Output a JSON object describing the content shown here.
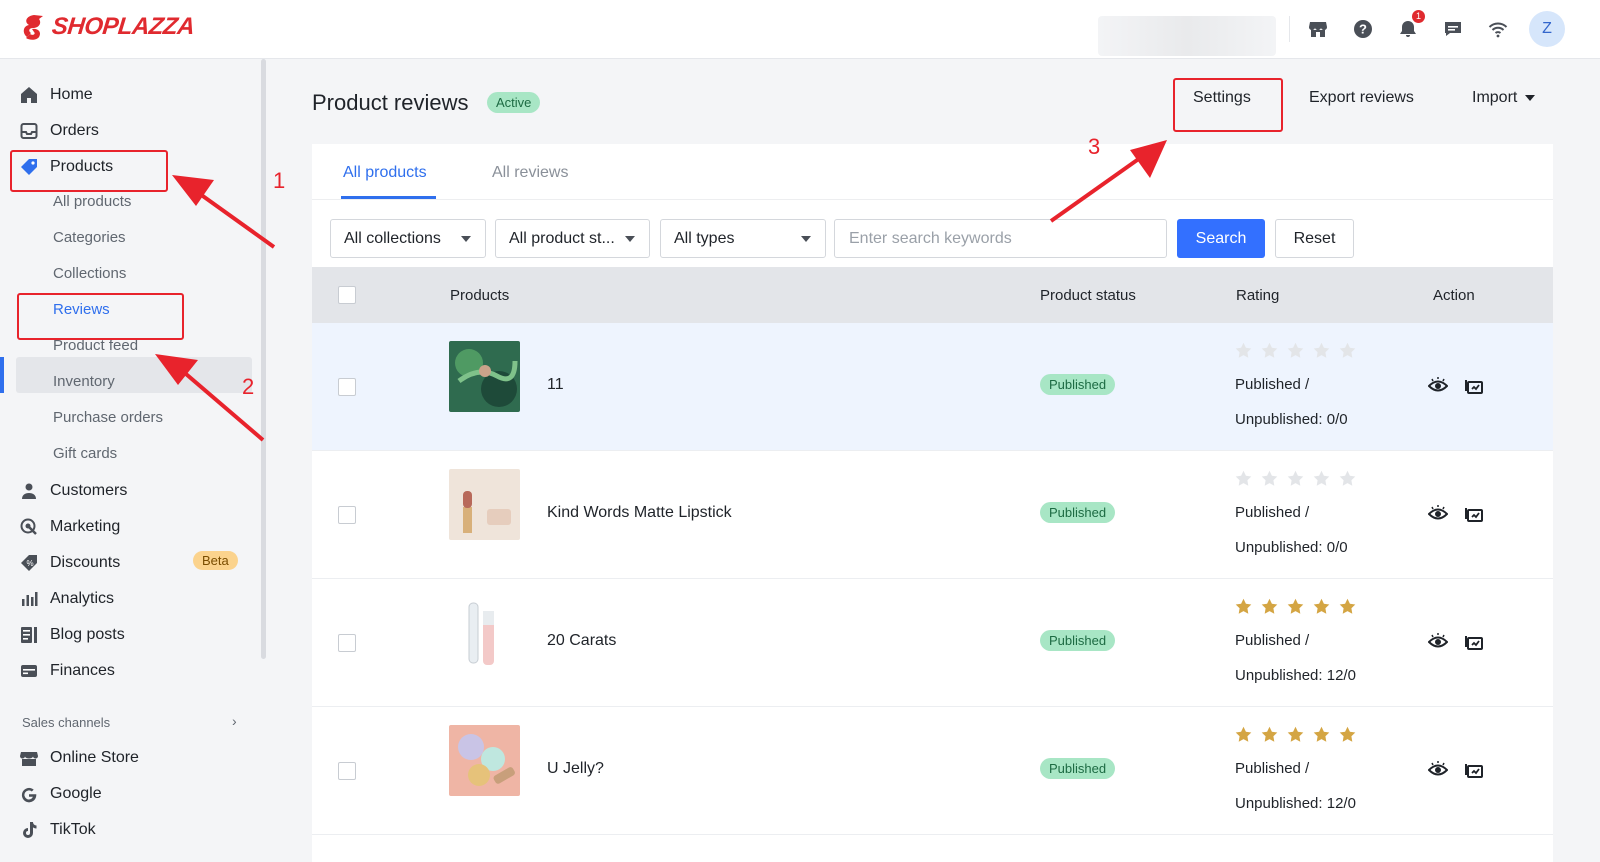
{
  "brand": {
    "name": "SHOPLAZZA",
    "accent": "#e02a2f"
  },
  "topbar": {
    "notification_count": "1",
    "avatar_initial": "Z"
  },
  "sidebar": {
    "items": [
      {
        "label": "Home",
        "icon": "home-icon"
      },
      {
        "label": "Orders",
        "icon": "inbox-icon"
      },
      {
        "label": "Products",
        "icon": "tag-icon"
      },
      {
        "label": "Customers",
        "icon": "person-icon"
      },
      {
        "label": "Marketing",
        "icon": "target-icon"
      },
      {
        "label": "Discounts",
        "icon": "discount-icon",
        "badge": "Beta"
      },
      {
        "label": "Analytics",
        "icon": "bar-chart-icon"
      },
      {
        "label": "Blog posts",
        "icon": "blog-icon"
      },
      {
        "label": "Finances",
        "icon": "wallet-icon"
      }
    ],
    "product_subitems": [
      "All products",
      "Categories",
      "Collections",
      "Reviews",
      "Product feed",
      "Inventory",
      "Purchase orders",
      "Gift cards"
    ],
    "active_subitem": "Reviews",
    "sales_channels_label": "Sales channels",
    "channels": [
      {
        "label": "Online Store",
        "icon": "store-icon"
      },
      {
        "label": "Google",
        "icon": "google-icon"
      },
      {
        "label": "TikTok",
        "icon": "tiktok-icon"
      }
    ]
  },
  "header": {
    "title": "Product reviews",
    "status_badge": "Active",
    "settings_label": "Settings",
    "export_label": "Export reviews",
    "import_label": "Import"
  },
  "tabs": [
    {
      "label": "All products",
      "active": true
    },
    {
      "label": "All reviews",
      "active": false
    }
  ],
  "filters": {
    "collections": "All collections",
    "product_status": "All product st...",
    "types": "All types",
    "search_placeholder": "Enter search keywords",
    "search_label": "Search",
    "reset_label": "Reset"
  },
  "table": {
    "columns": [
      "Products",
      "Product status",
      "Rating",
      "Action"
    ],
    "rows": [
      {
        "name": "11",
        "status": "Published",
        "stars": 0,
        "published": "Published /",
        "unpublished": "Unpublished: 0/0",
        "thumb": "green-art"
      },
      {
        "name": "Kind Words Matte Lipstick",
        "status": "Published",
        "stars": 0,
        "published": "Published /",
        "unpublished": "Unpublished: 0/0",
        "thumb": "lipstick"
      },
      {
        "name": "20 Carats",
        "status": "Published",
        "stars": 5,
        "published": "Published /",
        "unpublished": "Unpublished: 12/0",
        "thumb": "lipgloss"
      },
      {
        "name": "U Jelly?",
        "status": "Published",
        "stars": 5,
        "published": "Published /",
        "unpublished": "Unpublished: 12/0",
        "thumb": "cosmetics"
      }
    ]
  },
  "annotations": {
    "step1": "1",
    "step2": "2",
    "step3": "3",
    "color": "#e8232c"
  },
  "colors": {
    "primary": "#3370ff",
    "star_filled": "#d4a543",
    "star_empty": "#e3e5e8",
    "badge_green": "#a8e6c5"
  }
}
